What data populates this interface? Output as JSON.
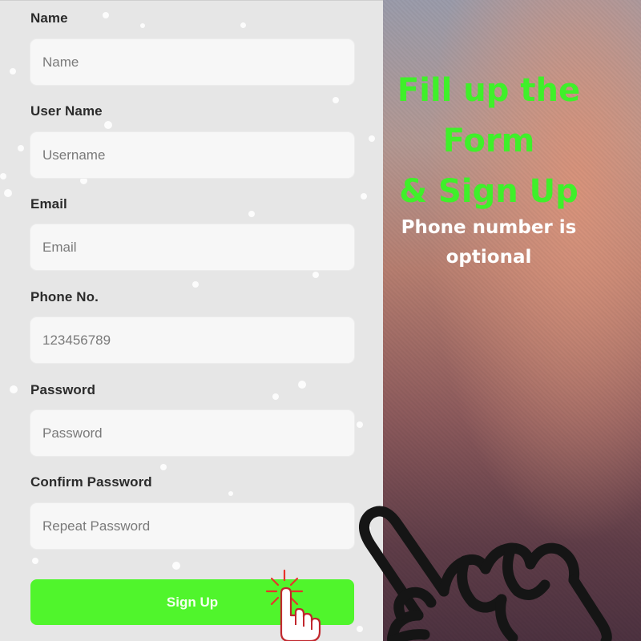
{
  "form": {
    "fields": [
      {
        "label": "Name",
        "placeholder": "Name",
        "value": ""
      },
      {
        "label": "User Name",
        "placeholder": "Username",
        "value": ""
      },
      {
        "label": "Email",
        "placeholder": "Email",
        "value": ""
      },
      {
        "label": "Phone No.",
        "placeholder": "123456789",
        "value": ""
      },
      {
        "label": "Password",
        "placeholder": "Password",
        "value": ""
      },
      {
        "label": "Confirm Password",
        "placeholder": "Repeat Password",
        "value": ""
      }
    ],
    "submit_label": "Sign Up"
  },
  "promo": {
    "title_lines": [
      "Fill up the",
      "Form",
      "& Sign Up"
    ],
    "subtitle_lines": [
      "Phone number is",
      "optional"
    ]
  },
  "icons": {
    "pointing_hand": "pointing-hand-icon",
    "click_cursor": "click-cursor-icon"
  },
  "colors": {
    "accent_green": "#50f52c",
    "title_green": "#3ff02a",
    "panel_bg": "#e6e6e6",
    "input_bg": "#f7f7f7"
  }
}
